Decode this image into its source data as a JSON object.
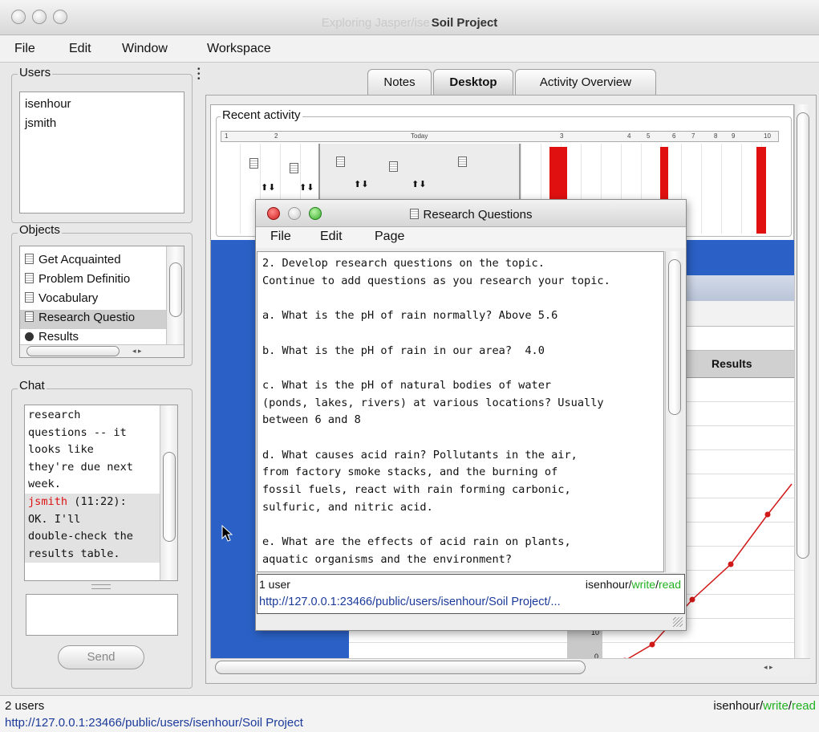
{
  "window": {
    "title_faded": "Exploring Jasper/ise",
    "title": "Soil Project"
  },
  "menu": [
    "File",
    "Edit",
    "Window",
    "Workspace"
  ],
  "users_panel": {
    "label": "Users",
    "items": [
      "isenhour",
      "jsmith"
    ]
  },
  "objects_panel": {
    "label": "Objects",
    "items": [
      "Get Acquainted",
      "Problem Definitio",
      "Vocabulary",
      "Research Questio",
      "Results"
    ],
    "selected_index": 3
  },
  "chat_panel": {
    "label": "Chat",
    "lines": [
      "research",
      "questions -- it",
      "looks like",
      "they're due next",
      "week."
    ],
    "reply_user": "jsmith",
    "reply_time": "(11:22):",
    "reply_lines": [
      "OK. I'll",
      "double-check the",
      "results table."
    ],
    "send_label": "Send"
  },
  "tabs": [
    "Notes",
    "Desktop",
    "Activity Overview"
  ],
  "active_tab": 1,
  "desktop": {
    "recent_label": "Recent activity",
    "timeline_today": "Today",
    "timeline_ticks": [
      "1",
      "2",
      "3",
      "4",
      "5",
      "6",
      "7",
      "8",
      "9",
      "10"
    ],
    "results_header": "Results",
    "axis_zero": "0",
    "axis_ten": "10"
  },
  "rq_window": {
    "title": "Research Questions",
    "menu": [
      "File",
      "Edit",
      "Page"
    ],
    "text": "2. Develop research questions on the topic.\nContinue to add questions as you research your topic.\n\na. What is the pH of rain normally? Above 5.6\n\nb. What is the pH of rain in our area?  4.0\n\nc. What is the pH of natural bodies of water\n(ponds, lakes, rivers) at various locations? Usually\nbetween 6 and 8\n\nd. What causes acid rain? Pollutants in the air,\nfrom factory smoke stacks, and the burning of\nfossil fuels, react with rain forming carbonic,\nsulfuric, and nitric acid.\n\ne. What are the effects of acid rain on plants,\naquatic organisms and the environment?\nAcid rain contaminates plants, soil, and water. It",
    "status_users": "1 user",
    "status_user": "isenhour",
    "status_write": "write",
    "status_read": "read",
    "url": "http://127.0.0.1:23466/public/users/isenhour/Soil Project/..."
  },
  "status": {
    "users": "2 users",
    "user": "isenhour",
    "write": "write",
    "read": "read",
    "url": "http://127.0.0.1:23466/public/users/isenhour/Soil Project",
    "sep": "/"
  },
  "colors": {
    "accent_blue": "#2b61c6",
    "activity_red": "#e01010",
    "write_green": "#21b121",
    "link_blue": "#1b3a99"
  }
}
